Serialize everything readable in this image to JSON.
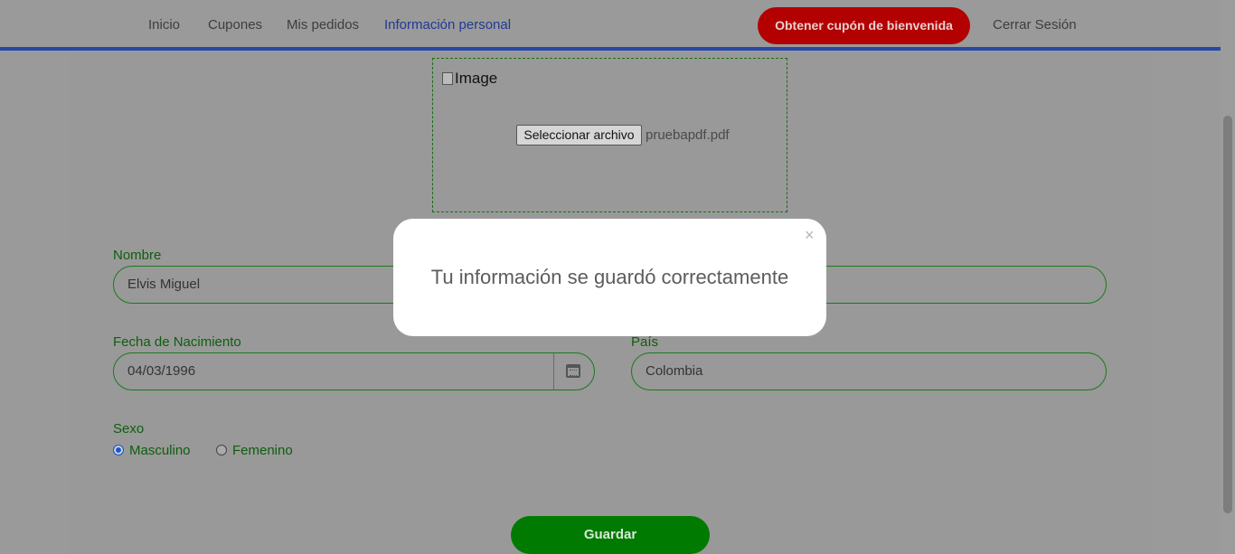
{
  "nav": {
    "items": [
      "Inicio",
      "Cupones",
      "Mis pedidos",
      "Información personal"
    ],
    "cta_label": "Obtener cupón de bienvenida",
    "logout_label": "Cerrar Sesión"
  },
  "upload": {
    "image_alt": "Image",
    "button_label": "Seleccionar archivo",
    "file_name": "pruebapdf.pdf"
  },
  "form": {
    "nombre_label": "Nombre",
    "nombre_value": "Elvis Miguel",
    "fecha_label": "Fecha de Nacimiento",
    "fecha_value": "04/03/1996",
    "pais_label": "País",
    "pais_value": "Colombia",
    "sexo_label": "Sexo",
    "options": [
      "Masculino",
      "Femenino"
    ],
    "selected_option": "Masculino",
    "save_label": "Guardar"
  },
  "modal": {
    "close_glyph": "×",
    "message": "Tu información se guardó correctamente"
  },
  "colors": {
    "accent_blue": "#2848a8",
    "cta_red": "#b30000",
    "form_green": "#0e5e0e",
    "save_green": "#007a00"
  }
}
